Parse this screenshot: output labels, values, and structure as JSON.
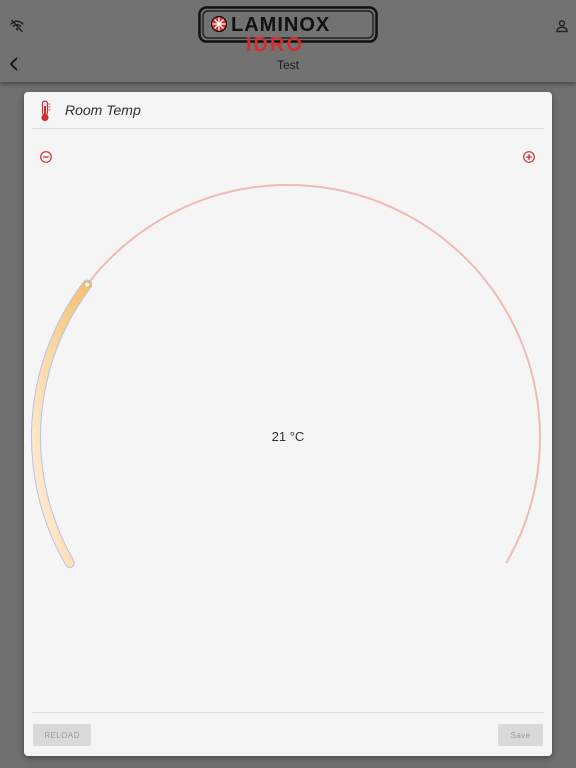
{
  "header": {
    "title": "Test",
    "logo_top": "LAMINOX",
    "logo_bottom": "IDRO"
  },
  "icons": {
    "wifi": "wifi-off-icon",
    "user": "user-icon",
    "back": "chevron-left-icon",
    "thermometer": "thermometer-icon",
    "minus": "minus-circle-icon",
    "plus": "plus-circle-icon"
  },
  "card": {
    "title": "Room Temp",
    "temperature_display": "21 °C",
    "dial_level": 0.28,
    "reload_label": "RELOAD",
    "save_label": "Save"
  },
  "colors": {
    "accent": "#d32f2f",
    "track": "#f2b8b8",
    "fill_start": "#fff1dd",
    "fill_end": "#f7c06d",
    "fill_edge": "#b6c3e6"
  }
}
